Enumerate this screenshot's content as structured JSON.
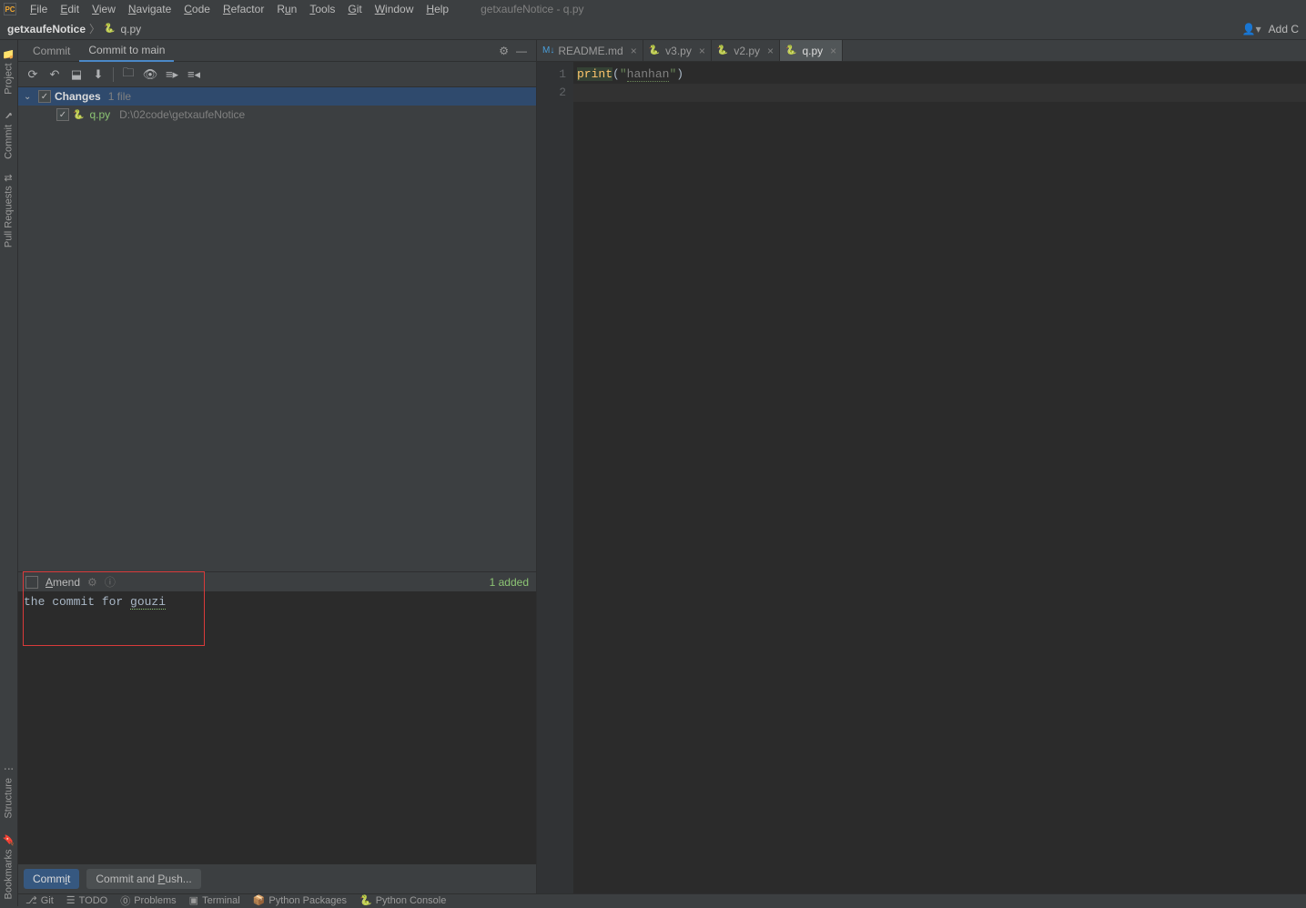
{
  "window": {
    "title": "getxaufeNotice - q.py"
  },
  "menu": {
    "file": "File",
    "edit": "Edit",
    "view": "View",
    "navigate": "Navigate",
    "code": "Code",
    "refactor": "Refactor",
    "run": "Run",
    "tools": "Tools",
    "git": "Git",
    "window": "Window",
    "help": "Help"
  },
  "breadcrumb": {
    "project": "getxaufeNotice",
    "file": "q.py"
  },
  "topright": {
    "add_config": "Add C"
  },
  "left_rail": {
    "project": "Project",
    "commit": "Commit",
    "pull_requests": "Pull Requests",
    "structure": "Structure",
    "bookmarks": "Bookmarks"
  },
  "commit_panel": {
    "tabs": {
      "commit": "Commit",
      "commit_to_main": "Commit to main"
    },
    "changes_label": "Changes",
    "file_count": "1 file",
    "file": {
      "name": "q.py",
      "path": "D:\\02code\\getxaufeNotice"
    },
    "amend": "Amend",
    "added_status": "1 added",
    "message_pre": "the commit for ",
    "message_word": "gouzi",
    "commit_btn": "Commit",
    "commit_push_btn": "Commit and Push..."
  },
  "editor": {
    "tabs": {
      "readme": "README.md",
      "v3": "v3.py",
      "v2": "v2.py",
      "q": "q.py"
    },
    "line_numbers": [
      "1",
      "2"
    ],
    "code": {
      "fn": "print",
      "lparen": "(",
      "str_quote1": "\"",
      "str_body": "hanhan",
      "str_quote2": "\"",
      "rparen": ")"
    }
  },
  "status_bar": {
    "git": "Git",
    "todo": "TODO",
    "problems": "Problems",
    "terminal": "Terminal",
    "py_packages": "Python Packages",
    "py_console": "Python Console"
  }
}
